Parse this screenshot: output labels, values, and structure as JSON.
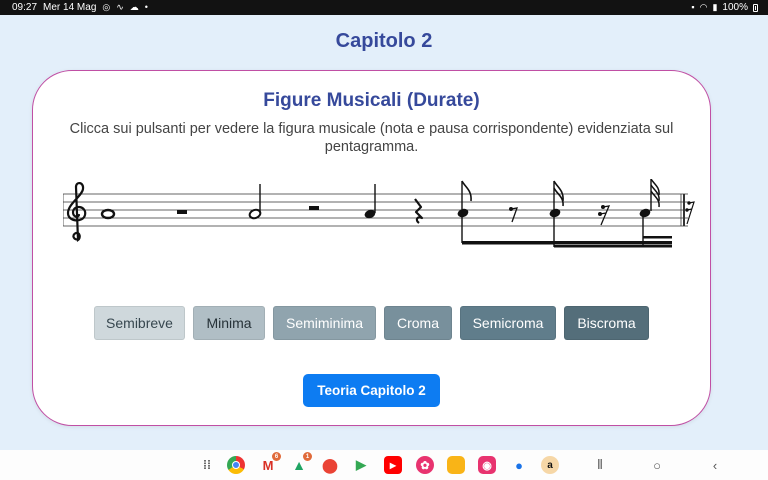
{
  "status_bar": {
    "time": "09:27",
    "date": "Mer 14 Mag",
    "battery": "100%",
    "icons": [
      "cast-icon",
      "signature-icon",
      "cloud-icon",
      "dot-icon",
      "sim-icon",
      "wifi-icon",
      "signal-icon",
      "battery-icon"
    ]
  },
  "page": {
    "chapter_title": "Capitolo 2"
  },
  "card": {
    "title": "Figure Musicali (Durate)",
    "description": "Clicca sui pulsanti per vedere la figura musicale (nota e pausa corrispondente) evidenziata sul pentagramma."
  },
  "staff": {
    "clef": "treble-clef",
    "figures": [
      "semibreve",
      "semibreve-rest",
      "minima",
      "minima-rest",
      "semiminima",
      "semiminima-rest",
      "croma",
      "croma-rest",
      "semicroma",
      "semicroma-rest",
      "biscroma",
      "biscroma-rest"
    ]
  },
  "duration_buttons": [
    {
      "label": "Semibreve",
      "bg": "#cfd8dc",
      "fg": "#37474f"
    },
    {
      "label": "Minima",
      "bg": "#b0bec5",
      "fg": "#263238"
    },
    {
      "label": "Semiminima",
      "bg": "#90a4ae",
      "fg": "#ffffff"
    },
    {
      "label": "Croma",
      "bg": "#78909c",
      "fg": "#ffffff"
    },
    {
      "label": "Semicroma",
      "bg": "#607d8b",
      "fg": "#ffffff"
    },
    {
      "label": "Biscroma",
      "bg": "#546e7a",
      "fg": "#ffffff"
    }
  ],
  "theory_button": {
    "label": "Teoria Capitolo 2",
    "color": "#0d7cf2"
  },
  "colors": {
    "page_bg": "#e3effa",
    "title": "#36499b",
    "card_border": "#c04fa4"
  },
  "nav_bar": {
    "apps": [
      {
        "name": "apps-grid-icon"
      },
      {
        "name": "chrome-icon"
      },
      {
        "name": "gmail-icon",
        "badge": "6"
      },
      {
        "name": "drive-icon",
        "badge": "1"
      },
      {
        "name": "maps-icon"
      },
      {
        "name": "play-store-icon"
      },
      {
        "name": "youtube-icon"
      },
      {
        "name": "flower-app-icon"
      },
      {
        "name": "files-icon"
      },
      {
        "name": "camera-app-icon"
      },
      {
        "name": "messages-icon"
      },
      {
        "name": "amazon-icon"
      }
    ],
    "system": [
      "recents-icon",
      "home-icon",
      "back-icon"
    ]
  }
}
